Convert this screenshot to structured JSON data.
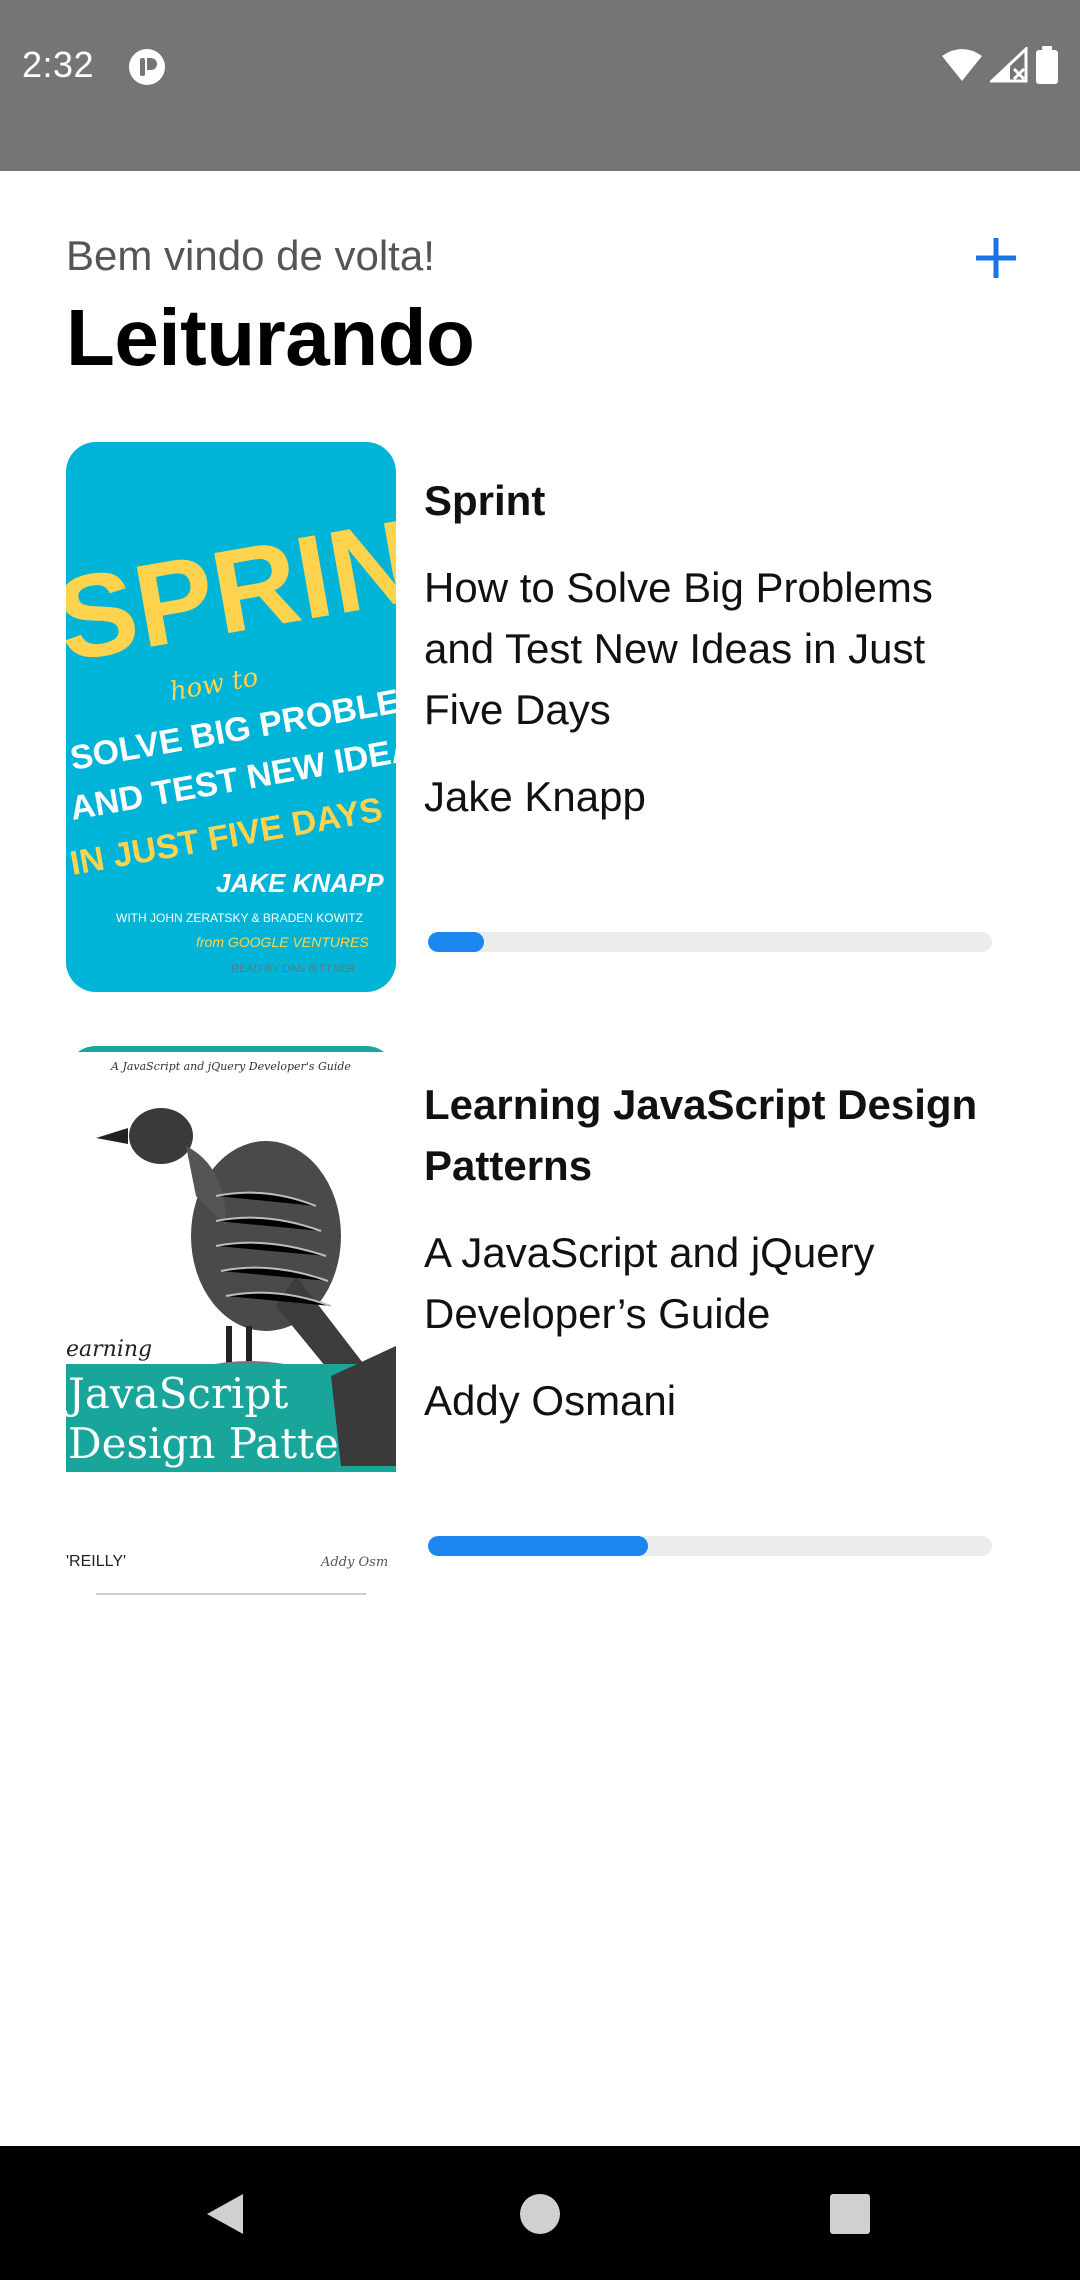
{
  "status_bar": {
    "time": "2:32",
    "icons": [
      "app-notification-icon",
      "wifi-icon",
      "cellular-signal-icon",
      "battery-icon"
    ]
  },
  "header": {
    "welcome_text": "Bem vindo de volta!",
    "title": "Leiturando",
    "add_icon": "plus-icon"
  },
  "books": [
    {
      "title": "Sprint",
      "subtitle": "How to Solve Big Problems and Test New Ideas in Just Five Days",
      "author": "Jake Knapp",
      "progress": 0.1,
      "cover": {
        "background": "#00b4d8",
        "lines": [
          "SPRINT",
          "how to",
          "SOLVE BIG PROBLEMS",
          "AND TEST NEW IDEAS",
          "IN JUST FIVE DAYS",
          "JAKE KNAPP",
          "WITH JOHN ZERATSKY & BRADEN KOWITZ",
          "from GOOGLE VENTURES",
          "READ BY DAN BITTNER"
        ]
      }
    },
    {
      "title": "Learning JavaScript Design Patterns",
      "subtitle": "A JavaScript and jQuery Developer’s Guide",
      "author": "Addy Osmani",
      "progress": 0.39,
      "cover": {
        "band_color": "#1aa59a",
        "lines": [
          "A JavaScript and jQuery Developer's Guide",
          "earning",
          "JavaScript",
          "Design Patterns",
          "'REILLY'",
          "Addy Osm"
        ]
      }
    }
  ],
  "colors": {
    "accent": "#1a86ee",
    "progress_track": "#ececec",
    "status_bar": "#757575"
  },
  "nav_bar": {
    "icons": [
      "back-triangle-icon",
      "home-circle-icon",
      "recents-square-icon"
    ]
  }
}
